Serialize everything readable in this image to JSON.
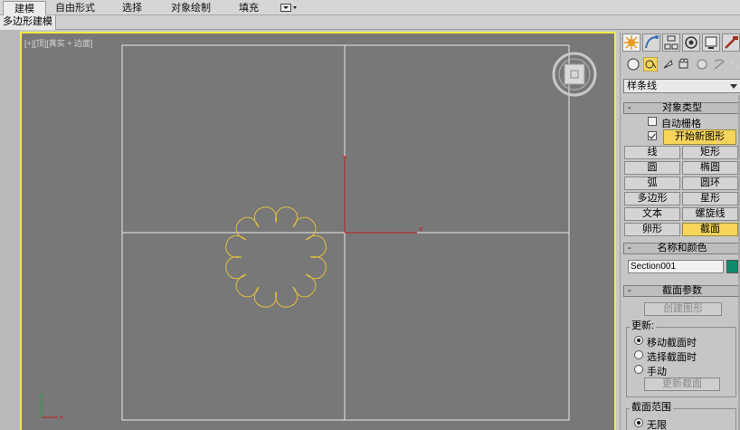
{
  "ribbon": {
    "tabs": [
      {
        "label": "建模",
        "active": true
      },
      {
        "label": "自由形式",
        "active": false
      },
      {
        "label": "选择",
        "active": false
      },
      {
        "label": "对象绘制",
        "active": false
      },
      {
        "label": "填充",
        "active": false
      }
    ],
    "dropdown_icon": "dropdown-toggle-icon",
    "sub_tab": "多边形建模"
  },
  "viewport": {
    "label": "[+][顶][真实 + 边面]",
    "border_color": "#f5e94a",
    "background": "#787878",
    "shape_color": "#e0c040",
    "axis_colors": {
      "x": "#c02020",
      "y": "#20a040"
    },
    "axis_labels": {
      "x": "x",
      "y": "y"
    }
  },
  "command_panel": {
    "tabs": [
      {
        "icon": "create-icon",
        "active": true
      },
      {
        "icon": "modify-icon",
        "active": false
      },
      {
        "icon": "hierarchy-icon",
        "active": false
      },
      {
        "icon": "motion-icon",
        "active": false
      },
      {
        "icon": "display-icon",
        "active": false
      },
      {
        "icon": "utilities-icon",
        "active": false
      }
    ],
    "sub_categories": [
      "geometry-icon",
      "shapes-icon",
      "lights-icon",
      "cameras-icon",
      "helpers-icon",
      "space-warps-icon",
      "systems-icon"
    ],
    "category": "样条线",
    "object_type": {
      "title": "对象类型",
      "autogrid_label": "自动栅格",
      "autogrid_checked": false,
      "start_new_shape_checked": true,
      "start_new_shape_label": "开始新图形",
      "buttons": [
        [
          "线",
          "矩形"
        ],
        [
          "圆",
          "椭圆"
        ],
        [
          "弧",
          "圆环"
        ],
        [
          "多边形",
          "星形"
        ],
        [
          "文本",
          "螺旋线"
        ],
        [
          "卵形",
          "截面"
        ]
      ],
      "active_button": "截面"
    },
    "name_color": {
      "title": "名称和颜色",
      "name": "Section001",
      "color": "#0f8a6c"
    },
    "section_params": {
      "title": "截面参数",
      "create_shape_label": "创建图形",
      "update_group_label": "更新:",
      "update_options": [
        "移动截面时",
        "选择截面时",
        "手动"
      ],
      "update_selected": 0,
      "update_section_label": "更新截面",
      "extents_group_label": "截面范围",
      "extents_option": "无限",
      "extents_selected": true
    }
  }
}
